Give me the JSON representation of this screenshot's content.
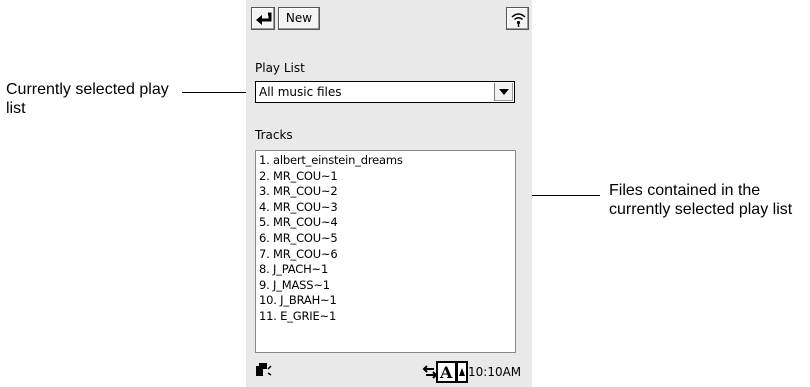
{
  "annotations": {
    "left": "Currently selected play list",
    "right": "Files contained in the currently selected play list"
  },
  "toolbar": {
    "new_label": "New",
    "back_icon": "return-arrow-icon",
    "help_icon": "help-icon"
  },
  "playlist": {
    "label": "Play List",
    "selected": "All music files"
  },
  "tracks": {
    "label": "Tracks",
    "items": [
      "1. albert_einstein_dreams",
      "2. MR_COU~1",
      "3. MR_COU~2",
      "4. MR_COU~3",
      "5. MR_COU~4",
      "6. MR_COU~5",
      "7. MR_COU~6",
      "8. J_PACH~1",
      "9. J_MASS~1",
      "10. J_BRAH~1",
      "11. E_GRIE~1"
    ]
  },
  "statusbar": {
    "time": "10:10AM",
    "icons": [
      "music-player-icon",
      "input-switch-icon",
      "text-input-a-icon"
    ]
  }
}
